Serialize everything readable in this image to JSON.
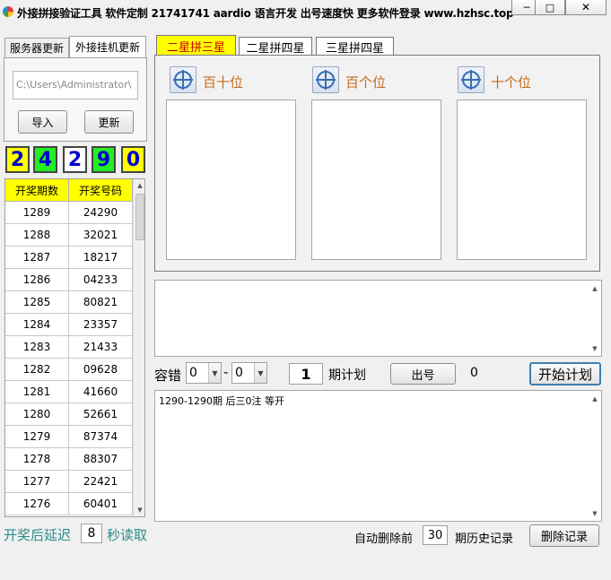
{
  "window": {
    "title": "外接拼接验证工具 软件定制 21741741 aardio 语言开发 出号速度快 更多软件登录 www.hzhsc.top",
    "min_glyph": "─",
    "max_glyph": "□",
    "close_glyph": "✕"
  },
  "left_tabs": [
    {
      "label": "服务器更新"
    },
    {
      "label": "外接挂机更新"
    }
  ],
  "path_input": {
    "value": "C:\\Users\\Administrator\\"
  },
  "buttons": {
    "import": "导入",
    "update": "更新",
    "draw": "出号",
    "start_plan": "开始计划",
    "delete_records": "删除记录"
  },
  "digits": [
    {
      "value": "2",
      "bg": "#ffff00"
    },
    {
      "value": "4",
      "bg": "#22ee22"
    },
    {
      "value": "2",
      "bg": "#ffffff"
    },
    {
      "value": "9",
      "bg": "#22ee22"
    },
    {
      "value": "0",
      "bg": "#ffff00"
    }
  ],
  "history_table": {
    "headers": [
      "开奖期数",
      "开奖号码"
    ],
    "rows": [
      [
        "1289",
        "24290"
      ],
      [
        "1288",
        "32021"
      ],
      [
        "1287",
        "18217"
      ],
      [
        "1286",
        "04233"
      ],
      [
        "1285",
        "80821"
      ],
      [
        "1284",
        "23357"
      ],
      [
        "1283",
        "21433"
      ],
      [
        "1282",
        "09628"
      ],
      [
        "1281",
        "41660"
      ],
      [
        "1280",
        "52661"
      ],
      [
        "1279",
        "87374"
      ],
      [
        "1278",
        "88307"
      ],
      [
        "1277",
        "22421"
      ],
      [
        "1276",
        "60401"
      ]
    ]
  },
  "delay": {
    "prefix": "开奖后延迟",
    "value": "8",
    "suffix": "秒读取"
  },
  "right_tabs": [
    {
      "label": "二星拼三星",
      "active": true
    },
    {
      "label": "二星拼四星",
      "active": false
    },
    {
      "label": "三星拼四星",
      "active": false
    }
  ],
  "positions": [
    {
      "label": "百十位"
    },
    {
      "label": "百个位"
    },
    {
      "label": "十个位"
    }
  ],
  "controls": {
    "tolerance_label": "容错",
    "tolerance_from": "0",
    "dash": "-",
    "tolerance_to": "0",
    "period_count": "1",
    "period_label": "期计划",
    "draw_count": "0"
  },
  "log": {
    "text": "1290-1290期 后三0注 等开"
  },
  "footer": {
    "auto_delete_prefix": "自动删除前",
    "auto_delete_value": "30",
    "auto_delete_suffix": "期历史记录"
  },
  "colors": {
    "header_yellow": "#ffff00",
    "digit_blue": "#0000cc",
    "label_orange": "#c46a1a",
    "teal_text": "#2c8c8c",
    "active_tab_red": "#cc0000"
  }
}
